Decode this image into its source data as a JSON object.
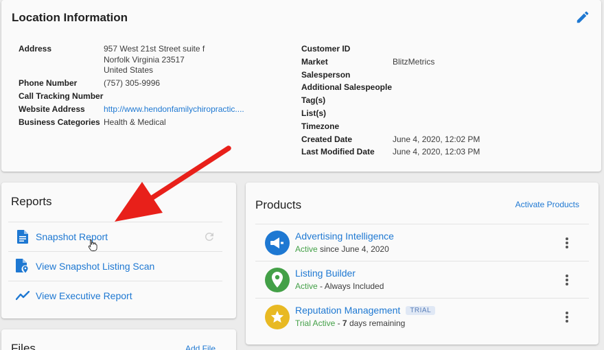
{
  "location": {
    "title": "Location Information",
    "address_label": "Address",
    "address_line1": "957 West 21st Street suite f",
    "address_line2": "Norfolk Virginia 23517",
    "address_line3": "United States",
    "phone_label": "Phone Number",
    "phone_value": "(757) 305-9996",
    "call_tracking_label": "Call Tracking Number",
    "website_label": "Website Address",
    "website_value": "http://www.hendonfamilychiropractic....",
    "categories_label": "Business Categories",
    "categories_value": "Health & Medical",
    "customer_id_label": "Customer ID",
    "market_label": "Market",
    "market_value": "BlitzMetrics",
    "salesperson_label": "Salesperson",
    "additional_salespeople_label": "Additional Salespeople",
    "tags_label": "Tag(s)",
    "lists_label": "List(s)",
    "timezone_label": "Timezone",
    "created_label": "Created Date",
    "created_value": "June 4, 2020, 12:02 PM",
    "modified_label": "Last Modified Date",
    "modified_value": "June 4, 2020, 12:03 PM"
  },
  "reports": {
    "title": "Reports",
    "items": [
      {
        "label": "Snapshot Report",
        "icon": "document-icon"
      },
      {
        "label": "View Snapshot Listing Scan",
        "icon": "document-pin-icon"
      },
      {
        "label": "View Executive Report",
        "icon": "trending-line-icon"
      }
    ]
  },
  "files": {
    "title": "Files",
    "add_label": "Add File"
  },
  "products": {
    "title": "Products",
    "activate_label": "Activate Products",
    "items": [
      {
        "name": "Advertising Intelligence",
        "status": "Active",
        "detail": " since June 4, 2020",
        "icon": "megaphone-icon",
        "color": "#1e78d2"
      },
      {
        "name": "Listing Builder",
        "status": "Active",
        "detail": " - Always Included",
        "icon": "map-pin-icon",
        "color": "#43a047"
      },
      {
        "name": "Reputation Management",
        "badge": "TRIAL",
        "status": "Trial Active",
        "detail_sep": " - ",
        "detail_bold": "7",
        "detail_tail": " days remaining",
        "icon": "star-icon",
        "color": "#e8b923"
      }
    ]
  },
  "colors": {
    "link": "#1e78d2",
    "active": "#43a047",
    "annotation_arrow": "#e8201a"
  }
}
